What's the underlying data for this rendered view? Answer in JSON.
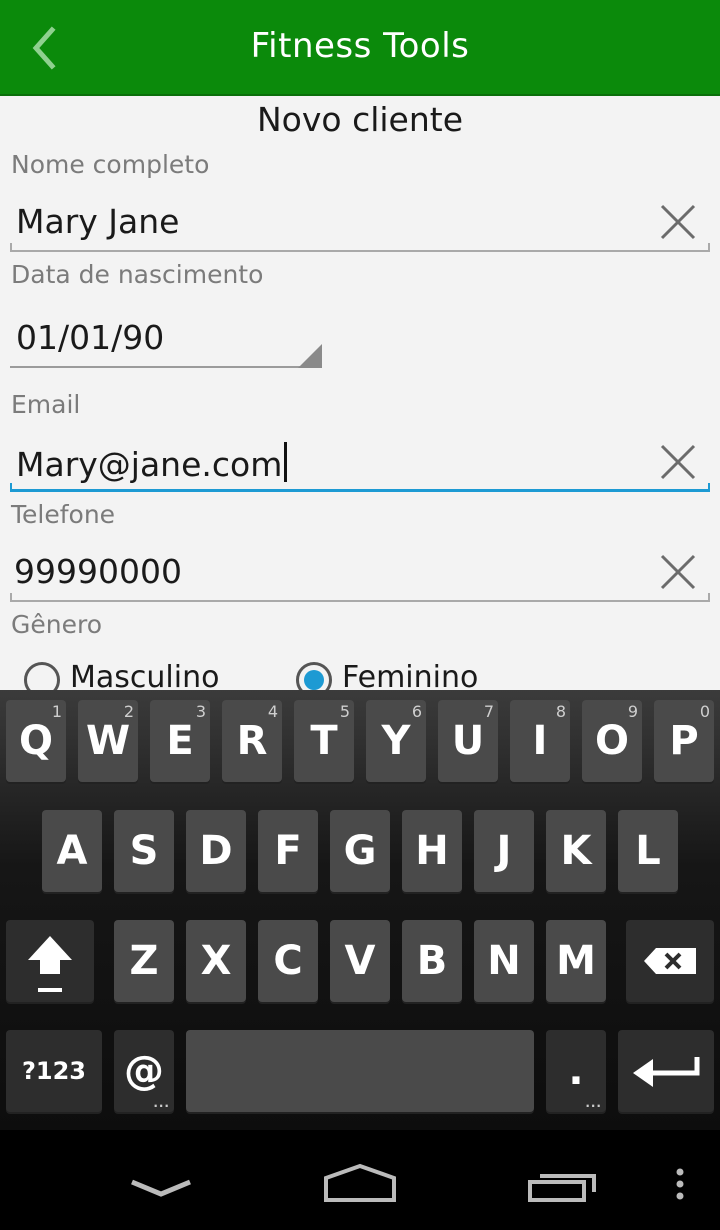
{
  "app": {
    "title": "Fitness Tools"
  },
  "form": {
    "title": "Novo cliente",
    "name": {
      "label": "Nome completo",
      "value": "Mary Jane"
    },
    "birth": {
      "label": "Data de nascimento",
      "value": "01/01/90"
    },
    "email": {
      "label": "Email",
      "value": "Mary@jane.com"
    },
    "phone": {
      "label": "Telefone",
      "value": "99990000"
    },
    "gender": {
      "label": "Gênero",
      "options": [
        "Masculino",
        "Feminino"
      ],
      "selected": "Feminino"
    }
  },
  "keyboard": {
    "row1": [
      {
        "key": "Q",
        "hint": "1"
      },
      {
        "key": "W",
        "hint": "2"
      },
      {
        "key": "E",
        "hint": "3"
      },
      {
        "key": "R",
        "hint": "4"
      },
      {
        "key": "T",
        "hint": "5"
      },
      {
        "key": "Y",
        "hint": "6"
      },
      {
        "key": "U",
        "hint": "7"
      },
      {
        "key": "I",
        "hint": "8"
      },
      {
        "key": "O",
        "hint": "9"
      },
      {
        "key": "P",
        "hint": "0"
      }
    ],
    "row2": [
      "A",
      "S",
      "D",
      "F",
      "G",
      "H",
      "J",
      "K",
      "L"
    ],
    "row3": [
      "Z",
      "X",
      "C",
      "V",
      "B",
      "N",
      "M"
    ],
    "symbols_label": "?123",
    "at_label": "@",
    "period_label": ".",
    "shift_icon": "shift-arrow-icon",
    "backspace_icon": "backspace-icon",
    "enter_icon": "enter-arrow-icon"
  },
  "navbar": {
    "icons": [
      "back-chevron-icon",
      "home-icon",
      "recents-icon",
      "menu-dots-icon"
    ]
  },
  "colors": {
    "appbar": "#0b8a0b",
    "accent": "#1d9ad3",
    "form_bg": "#f3f3f3"
  }
}
